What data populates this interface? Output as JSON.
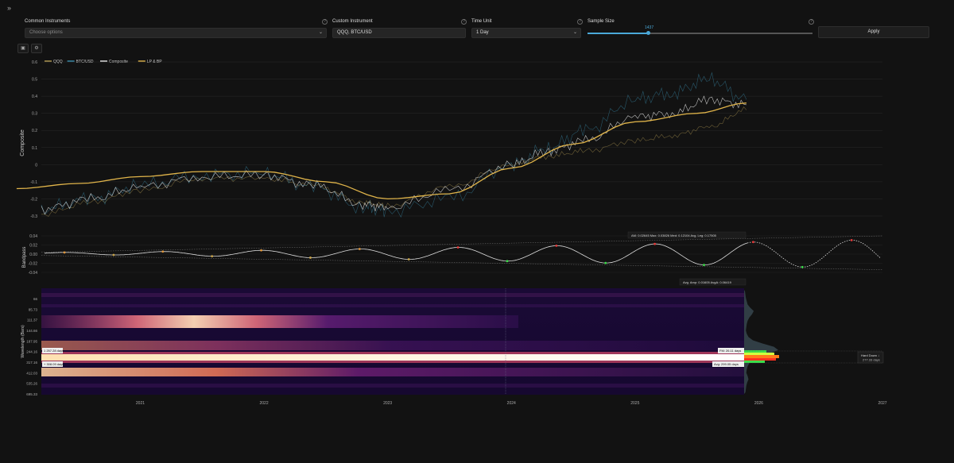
{
  "header": {
    "expand_icon": "chevrons-right-icon"
  },
  "controls": {
    "common_label": "Common Instruments",
    "common_placeholder": "Choose options",
    "custom_label": "Custom Instrument",
    "custom_value": "QQQ, BTC/USD",
    "time_unit_label": "Time Unit",
    "time_unit_value": "1 Day",
    "sample_label": "Sample Size",
    "sample_value": "1437",
    "sample_fraction": 0.27,
    "apply_label": "Apply"
  },
  "toolbar": {
    "icons": [
      "image-icon",
      "settings-icon"
    ]
  },
  "legend": [
    "QQQ",
    "BTC/USD",
    "Composite",
    "LP & BP"
  ],
  "colors": {
    "qqq": "#b89f55",
    "btc": "#3b8fb0",
    "composite": "#e8e8e8",
    "lpbp": "#e0b44a",
    "bg": "#121212"
  },
  "chart_data": [
    {
      "type": "line",
      "ylabel": "Composite",
      "yticks": [
        "0.6",
        "0.5",
        "0.4",
        "0.3",
        "0.2",
        "0.1",
        "0",
        "-0.1",
        "-0.2",
        "-0.3"
      ],
      "ylim": [
        -0.3,
        0.6
      ],
      "series": [
        {
          "name": "QQQ",
          "x": [
            2020.2,
            2020.6,
            2021.0,
            2021.5,
            2022.0,
            2022.4,
            2022.8,
            2023.0,
            2023.5,
            2024.0,
            2024.3,
            2024.6,
            2025.0,
            2025.3,
            2025.6,
            2025.9
          ],
          "y": [
            -0.29,
            -0.22,
            -0.15,
            -0.08,
            -0.08,
            -0.12,
            -0.22,
            -0.24,
            -0.13,
            0.0,
            0.05,
            0.08,
            0.14,
            0.17,
            0.22,
            0.32
          ]
        },
        {
          "name": "BTC/USD",
          "x": [
            2020.2,
            2020.6,
            2021.0,
            2021.5,
            2022.0,
            2022.4,
            2022.8,
            2023.0,
            2023.5,
            2024.0,
            2024.3,
            2024.6,
            2025.0,
            2025.3,
            2025.6,
            2025.9
          ],
          "y": [
            -0.26,
            -0.2,
            -0.12,
            -0.06,
            -0.05,
            -0.13,
            -0.25,
            -0.27,
            -0.2,
            0.0,
            0.1,
            0.2,
            0.38,
            0.42,
            0.5,
            0.38
          ]
        },
        {
          "name": "Composite",
          "x": [
            2020.2,
            2020.6,
            2021.0,
            2021.5,
            2022.0,
            2022.4,
            2022.8,
            2023.0,
            2023.5,
            2024.0,
            2024.3,
            2024.6,
            2025.0,
            2025.3,
            2025.6,
            2025.9
          ],
          "y": [
            -0.26,
            -0.2,
            -0.13,
            -0.07,
            -0.06,
            -0.12,
            -0.23,
            -0.25,
            -0.15,
            0.0,
            0.08,
            0.14,
            0.28,
            0.3,
            0.38,
            0.35
          ]
        },
        {
          "name": "LP & BP",
          "x": [
            2020.0,
            2020.5,
            2021.0,
            2021.5,
            2022.0,
            2022.5,
            2023.0,
            2023.5,
            2024.0,
            2024.5,
            2025.0,
            2025.5,
            2025.9
          ],
          "y": [
            -0.14,
            -0.11,
            -0.07,
            -0.04,
            -0.04,
            -0.1,
            -0.2,
            -0.17,
            -0.02,
            0.12,
            0.25,
            0.3,
            0.36
          ]
        }
      ]
    },
    {
      "type": "line",
      "ylabel": "Bandpass",
      "yticks": [
        "0.04",
        "0.02",
        "0.00",
        "-0.02",
        "-0.04"
      ],
      "ylim": [
        -0.04,
        0.04
      ],
      "stats_top": [
        "AM: 0.02645",
        "Max: 0.03826",
        "Med: 0.12104",
        "Avg. Leg: 0.17505"
      ],
      "stats_bottom": [
        "Avg. Amp: 0.01605",
        "AvgA: 0.06419"
      ]
    },
    {
      "type": "heatmap",
      "ylabel": "Wavelength (Bars)",
      "yticks": [
        "66",
        "85.73",
        "111.37",
        "144.66",
        "187.95",
        "244.16",
        "317.16",
        "412.03",
        "535.26",
        "695.33"
      ],
      "xticks": [
        "2021",
        "2022",
        "2023",
        "2024",
        "2025",
        "2026",
        "2027"
      ],
      "left_tags": [
        "1 257.28 days",
        "+ 308.09 days"
      ],
      "right_tags": [
        "FM: 26.11 days",
        "Avg: 299.05 days"
      ],
      "badge_title": "Hard Down ↓",
      "badge_value": "277.33 days"
    }
  ]
}
